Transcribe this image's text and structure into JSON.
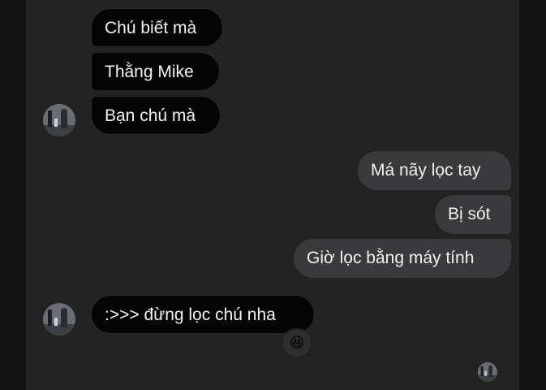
{
  "conversation": {
    "messages": [
      {
        "id": "m1",
        "direction": "incoming",
        "text": "Chú biết mà"
      },
      {
        "id": "m2",
        "direction": "incoming",
        "text": "Thằng Mike"
      },
      {
        "id": "m3",
        "direction": "incoming",
        "text": "Bạn chú mà"
      },
      {
        "id": "m4",
        "direction": "outgoing",
        "text": "Má nãy lọc tay"
      },
      {
        "id": "m5",
        "direction": "outgoing",
        "text": "Bị sót"
      },
      {
        "id": "m6",
        "direction": "outgoing",
        "text": "Giờ lọc bằng máy tính"
      },
      {
        "id": "m7",
        "direction": "incoming",
        "text": ":>>> đừng lọc chú nha",
        "reaction": "😆"
      }
    ],
    "seen_indicator_icon": "avatar-thumbnail",
    "colors": {
      "incoming_bubble": "#050505",
      "outgoing_bubble": "#3a3a3c",
      "background": "#232324",
      "text": "#f2f2f2"
    }
  }
}
